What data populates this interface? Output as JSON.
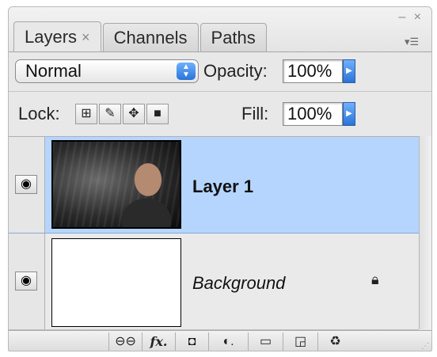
{
  "window": {
    "controls": "– ×",
    "menu_icon": "▾☰"
  },
  "tabs": [
    {
      "label": "Layers",
      "close": "×",
      "active": true
    },
    {
      "label": "Channels",
      "active": false
    },
    {
      "label": "Paths",
      "active": false
    }
  ],
  "blend": {
    "mode": "Normal",
    "opacity_label": "Opacity:",
    "opacity_value": "100%"
  },
  "lock": {
    "label": "Lock:",
    "fill_label": "Fill:",
    "fill_value": "100%",
    "icons": [
      "lock-transparent-icon",
      "lock-image-icon",
      "lock-position-icon",
      "lock-all-icon"
    ]
  },
  "layers": [
    {
      "name": "Layer 1",
      "visible": true,
      "selected": true,
      "thumbnail": "photo",
      "locked": false
    },
    {
      "name": "Background",
      "visible": true,
      "selected": false,
      "thumbnail": "white",
      "locked": true
    }
  ],
  "toolbar": {
    "icons": [
      "link-icon",
      "fx-icon",
      "mask-icon",
      "adjustment-icon",
      "folder-icon",
      "new-layer-icon",
      "trash-icon"
    ]
  },
  "colors": {
    "selection": "#b5d5ff",
    "accent": "#2a74d8",
    "panel": "#e8e8e8"
  }
}
